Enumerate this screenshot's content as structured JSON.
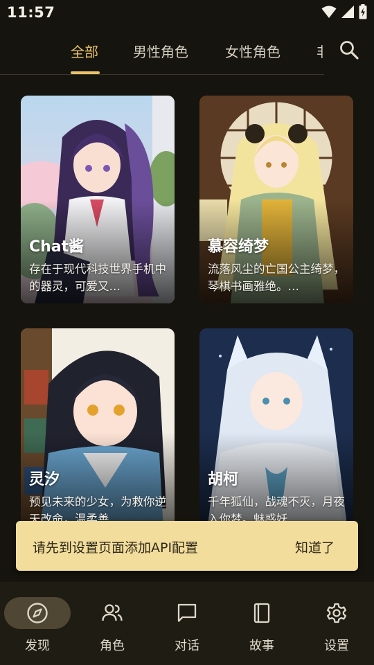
{
  "status_bar": {
    "time": "11:57"
  },
  "tabs": [
    {
      "label": "全部",
      "active": true
    },
    {
      "label": "男性角色",
      "active": false
    },
    {
      "label": "女性角色",
      "active": false
    },
    {
      "label": "非",
      "active": false
    }
  ],
  "search": {
    "icon": "search-icon"
  },
  "characters": [
    {
      "name": "Chat酱",
      "description": "存在于现代科技世界手机中的器灵，可爱又…"
    },
    {
      "name": "慕容绮梦",
      "description": "流落风尘的亡国公主绮梦，琴棋书画雅绝。…"
    },
    {
      "name": "灵汐",
      "description": "预见未来的少女，为救你逆天改命，温柔善…"
    },
    {
      "name": "胡柯",
      "description": "千年狐仙，战魂不灭，月夜入你梦。魅惑妖…"
    }
  ],
  "snackbar": {
    "message": "请先到设置页面添加API配置",
    "action": "知道了"
  },
  "bottom_nav": [
    {
      "label": "发现",
      "icon": "compass-icon",
      "active": true
    },
    {
      "label": "角色",
      "icon": "people-icon",
      "active": false
    },
    {
      "label": "对话",
      "icon": "chat-bubble-icon",
      "active": false
    },
    {
      "label": "故事",
      "icon": "book-icon",
      "active": false
    },
    {
      "label": "设置",
      "icon": "gear-icon",
      "active": false
    }
  ],
  "colors": {
    "background": "#16140e",
    "accent": "#e8c36a",
    "snackbar": "#f3dd9c",
    "nav_bg": "#1f1c14",
    "nav_active_pill": "#4f4733"
  }
}
